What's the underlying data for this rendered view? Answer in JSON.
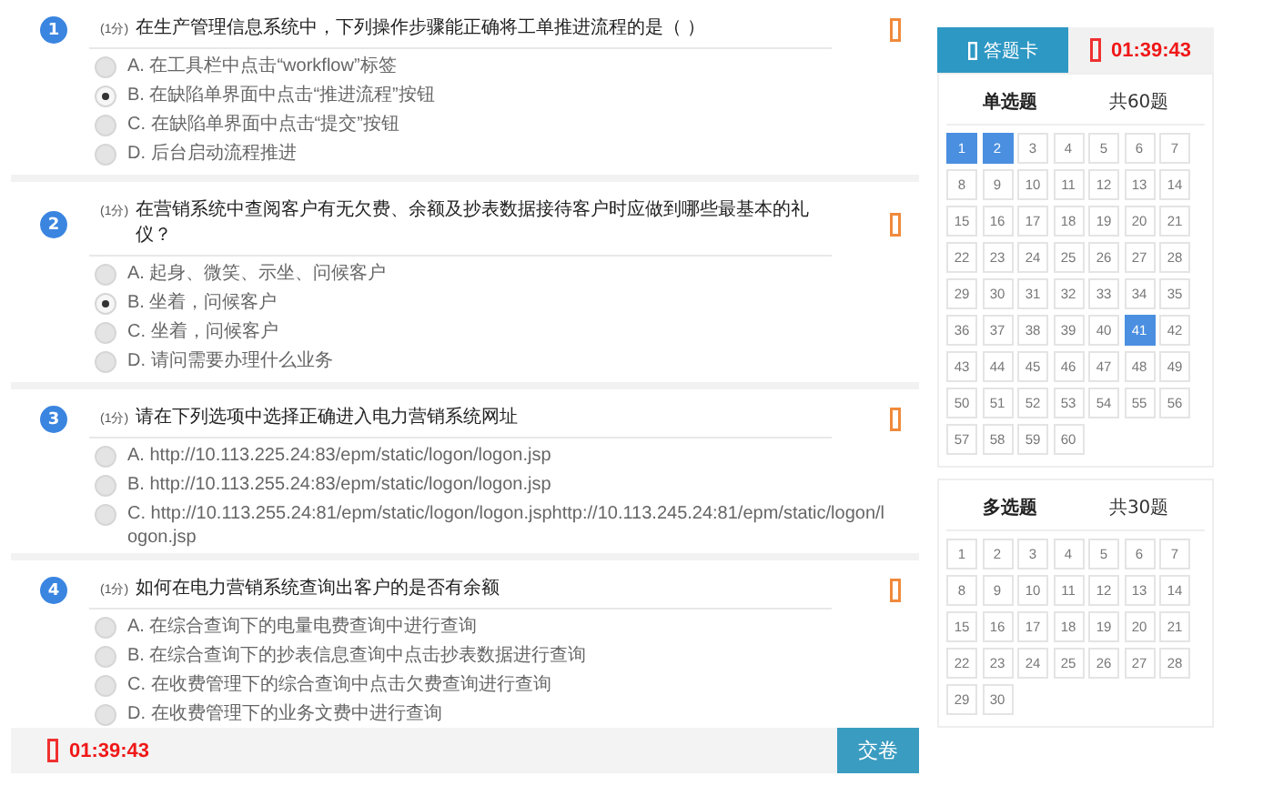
{
  "questions": [
    {
      "number": "1",
      "score": "(1分)",
      "title": "在生产管理信息系统中，下列操作步骤能正确将工单推进流程的是（ ）",
      "options": [
        {
          "text": "A. 在工具栏中点击“workflow”标签",
          "selected": false
        },
        {
          "text": "B. 在缺陷单界面中点击“推进流程”按钮",
          "selected": true
        },
        {
          "text": "C. 在缺陷单界面中点击“提交”按钮",
          "selected": false
        },
        {
          "text": "D. 后台启动流程推进",
          "selected": false
        }
      ]
    },
    {
      "number": "2",
      "score": "(1分)",
      "title": "在营销系统中查阅客户有无欠费、余额及抄表数据接待客户时应做到哪些最基本的礼仪？",
      "options": [
        {
          "text": "A. 起身、微笑、示坐、问候客户",
          "selected": false
        },
        {
          "text": "B. 坐着，问候客户",
          "selected": true
        },
        {
          "text": "C. 坐着，问候客户",
          "selected": false
        },
        {
          "text": "D. 请问需要办理什么业务",
          "selected": false
        }
      ]
    },
    {
      "number": "3",
      "score": "(1分)",
      "title": "请在下列选项中选择正确进入电力营销系统网址",
      "options": [
        {
          "text": "A. http://10.113.225.24:83/epm/static/logon/logon.jsp",
          "selected": false
        },
        {
          "text": "B. http://10.113.255.24:83/epm/static/logon/logon.jsp",
          "selected": false
        },
        {
          "text": "C. http://10.113.255.24:81/epm/static/logon/logon.jsphttp://10.113.245.24:81/epm/static/logon/logon.jsp",
          "selected": false
        }
      ]
    },
    {
      "number": "4",
      "score": "(1分)",
      "title": "如何在电力营销系统查询出客户的是否有余额",
      "options": [
        {
          "text": "A. 在综合查询下的电量电费查询中进行查询",
          "selected": false
        },
        {
          "text": "B. 在综合查询下的抄表信息查询中点击抄表数据进行查询",
          "selected": false
        },
        {
          "text": "C. 在收费管理下的综合查询中点击欠费查询进行查询",
          "selected": false
        },
        {
          "text": "D. 在收费管理下的业务文费中进行查询",
          "selected": false
        }
      ]
    }
  ],
  "bottom_bar": {
    "timer": "01:39:43",
    "submit": "交卷"
  },
  "answer_card": {
    "tab": "答题卡",
    "timer": "01:39:43",
    "sections": [
      {
        "title": "单选题",
        "total": "共60题",
        "items": [
          {
            "label": "1",
            "answered": true
          },
          {
            "label": "2",
            "answered": true
          },
          {
            "label": "3",
            "answered": false
          },
          {
            "label": "4",
            "answered": false
          },
          {
            "label": "5",
            "answered": false
          },
          {
            "label": "6",
            "answered": false
          },
          {
            "label": "7",
            "answered": false
          },
          {
            "label": "8",
            "answered": false
          },
          {
            "label": "9",
            "answered": false
          },
          {
            "label": "10",
            "answered": false
          },
          {
            "label": "11",
            "answered": false
          },
          {
            "label": "12",
            "answered": false
          },
          {
            "label": "13",
            "answered": false
          },
          {
            "label": "14",
            "answered": false
          },
          {
            "label": "15",
            "answered": false
          },
          {
            "label": "16",
            "answered": false
          },
          {
            "label": "17",
            "answered": false
          },
          {
            "label": "18",
            "answered": false
          },
          {
            "label": "19",
            "answered": false
          },
          {
            "label": "20",
            "answered": false
          },
          {
            "label": "21",
            "answered": false
          },
          {
            "label": "22",
            "answered": false
          },
          {
            "label": "23",
            "answered": false
          },
          {
            "label": "24",
            "answered": false
          },
          {
            "label": "25",
            "answered": false
          },
          {
            "label": "26",
            "answered": false
          },
          {
            "label": "27",
            "answered": false
          },
          {
            "label": "28",
            "answered": false
          },
          {
            "label": "29",
            "answered": false
          },
          {
            "label": "30",
            "answered": false
          },
          {
            "label": "31",
            "answered": false
          },
          {
            "label": "32",
            "answered": false
          },
          {
            "label": "33",
            "answered": false
          },
          {
            "label": "34",
            "answered": false
          },
          {
            "label": "35",
            "answered": false
          },
          {
            "label": "36",
            "answered": false
          },
          {
            "label": "37",
            "answered": false
          },
          {
            "label": "38",
            "answered": false
          },
          {
            "label": "39",
            "answered": false
          },
          {
            "label": "40",
            "answered": false
          },
          {
            "label": "41",
            "answered": true
          },
          {
            "label": "42",
            "answered": false
          },
          {
            "label": "43",
            "answered": false
          },
          {
            "label": "44",
            "answered": false
          },
          {
            "label": "45",
            "answered": false
          },
          {
            "label": "46",
            "answered": false
          },
          {
            "label": "47",
            "answered": false
          },
          {
            "label": "48",
            "answered": false
          },
          {
            "label": "49",
            "answered": false
          },
          {
            "label": "50",
            "answered": false
          },
          {
            "label": "51",
            "answered": false
          },
          {
            "label": "52",
            "answered": false
          },
          {
            "label": "53",
            "answered": false
          },
          {
            "label": "54",
            "answered": false
          },
          {
            "label": "55",
            "answered": false
          },
          {
            "label": "56",
            "answered": false
          },
          {
            "label": "57",
            "answered": false
          },
          {
            "label": "58",
            "answered": false
          },
          {
            "label": "59",
            "answered": false
          },
          {
            "label": "60",
            "answered": false
          }
        ]
      },
      {
        "title": "多选题",
        "total": "共30题",
        "items": [
          {
            "label": "1",
            "answered": false
          },
          {
            "label": "2",
            "answered": false
          },
          {
            "label": "3",
            "answered": false
          },
          {
            "label": "4",
            "answered": false
          },
          {
            "label": "5",
            "answered": false
          },
          {
            "label": "6",
            "answered": false
          },
          {
            "label": "7",
            "answered": false
          },
          {
            "label": "8",
            "answered": false
          },
          {
            "label": "9",
            "answered": false
          },
          {
            "label": "10",
            "answered": false
          },
          {
            "label": "11",
            "answered": false
          },
          {
            "label": "12",
            "answered": false
          },
          {
            "label": "13",
            "answered": false
          },
          {
            "label": "14",
            "answered": false
          },
          {
            "label": "15",
            "answered": false
          },
          {
            "label": "16",
            "answered": false
          },
          {
            "label": "17",
            "answered": false
          },
          {
            "label": "18",
            "answered": false
          },
          {
            "label": "19",
            "answered": false
          },
          {
            "label": "20",
            "answered": false
          },
          {
            "label": "21",
            "answered": false
          },
          {
            "label": "22",
            "answered": false
          },
          {
            "label": "23",
            "answered": false
          },
          {
            "label": "24",
            "answered": false
          },
          {
            "label": "25",
            "answered": false
          },
          {
            "label": "26",
            "answered": false
          },
          {
            "label": "27",
            "answered": false
          },
          {
            "label": "28",
            "answered": false
          },
          {
            "label": "29",
            "answered": false
          },
          {
            "label": "30",
            "answered": false
          }
        ]
      }
    ]
  }
}
